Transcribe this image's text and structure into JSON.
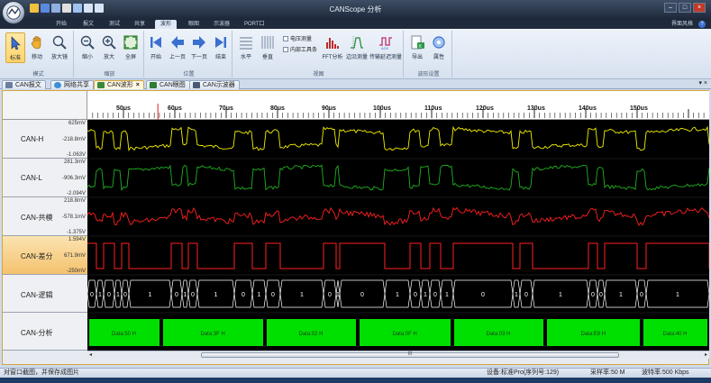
{
  "app": {
    "title": "CANScope 分析",
    "skin_menu": "界面风格",
    "help": "?"
  },
  "ribbon_tabs": [
    "开始",
    "报文",
    "测试",
    "共享",
    "波形",
    "眼图",
    "示波器",
    "PORT口"
  ],
  "ribbon_active_tab": 4,
  "ribbon": {
    "mode": {
      "label": "模式",
      "buttons": [
        "标准",
        "移动",
        "放大镜"
      ]
    },
    "zoom": {
      "label": "缩放",
      "buttons": [
        "缩小",
        "放大",
        "全屏"
      ]
    },
    "position": {
      "label": "位置",
      "buttons": [
        "开始",
        "上一页",
        "下一页",
        "结束"
      ]
    },
    "view": {
      "label": "视图",
      "buttons": [
        "水平",
        "垂直",
        "FFT分析",
        "边沿测量",
        "传输延迟测量"
      ],
      "checkboxes": [
        "电压测量",
        "内部工具条"
      ]
    },
    "wave_settings": {
      "label": "波形设置",
      "buttons": [
        "导出",
        "属性"
      ]
    }
  },
  "doc_tabs": [
    {
      "label": "CAN报文",
      "color": "#6a7f9f"
    },
    {
      "label": "网络共享",
      "color": "#3d8ed8"
    },
    {
      "label": "CAN波形",
      "color": "#3b8a3b",
      "active": true
    },
    {
      "label": "CAN眼图",
      "color": "#2e7d32"
    },
    {
      "label": "CAN示波器",
      "color": "#4a5a74"
    }
  ],
  "panel_controls": "▾ ×",
  "time_axis": {
    "labels": [
      "50us",
      "60us",
      "70us",
      "80us",
      "90us",
      "100us",
      "110us",
      "120us",
      "130us",
      "140us",
      "150us"
    ],
    "cursor_us": 56.7
  },
  "lanes": [
    {
      "name": "CAN-H",
      "top": "625mV",
      "mid": "-218.8mV",
      "bottom": "-1.063V",
      "color": "#f2f000"
    },
    {
      "name": "CAN-L",
      "top": "281.3mV",
      "mid": "-906.3mV",
      "bottom": "-2.094V",
      "color": "#20b020"
    },
    {
      "name": "CAN-共模",
      "top": "218.8mV",
      "mid": "-578.1mV",
      "bottom": "-1.375V",
      "color": "#ff2020"
    },
    {
      "name": "CAN-差分",
      "top": "1.594V",
      "mid": "671.9mV",
      "bottom": "-250mV",
      "color": "#ff2020"
    },
    {
      "name": "CAN-逻辑",
      "top": "",
      "mid": "",
      "bottom": "",
      "color": "#ffffff"
    },
    {
      "name": "CAN-分析",
      "top": "",
      "mid": "",
      "bottom": "",
      "color": "#00e000"
    }
  ],
  "logic_bits": [
    "0",
    "1",
    "0",
    "1",
    "0",
    "1",
    "0",
    "1",
    "0",
    "1",
    "0",
    "1",
    "0",
    "1",
    "0",
    "1",
    "0",
    "1",
    "0",
    "1",
    "0",
    "1",
    "0",
    "1",
    "0",
    "1",
    "0"
  ],
  "analysis_segments": [
    "Data:50 H",
    "Data:3F H",
    "Data:02 H",
    "Data:0F H",
    "Data:03 H",
    "Data:E8 H",
    "Data:40 H"
  ],
  "status": {
    "left": "对窗口截图，并保存成图片",
    "device": "设备:标准Pro(序列号:129)",
    "sample_rate": "采样率:50 M",
    "baud": "波特率:500 Kbps"
  },
  "scroll_grip": "III"
}
